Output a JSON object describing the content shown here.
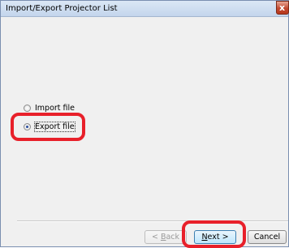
{
  "window": {
    "title": "Import/Export Projector List",
    "close_glyph": "x",
    "close_icon": "close-icon"
  },
  "options": {
    "import": {
      "label": "Import file",
      "checked": false
    },
    "export": {
      "label": "Export file",
      "checked": true
    }
  },
  "buttons": {
    "back": {
      "label_accel": "B",
      "label_rest": "ack",
      "prefix": "< ",
      "enabled": false
    },
    "next": {
      "label_accel": "N",
      "label_rest": "ext >",
      "enabled": true
    },
    "cancel": {
      "label": "Cancel",
      "enabled": true
    }
  },
  "colors": {
    "highlight": "#e8202a",
    "default_button_border": "#3c7fb1"
  }
}
